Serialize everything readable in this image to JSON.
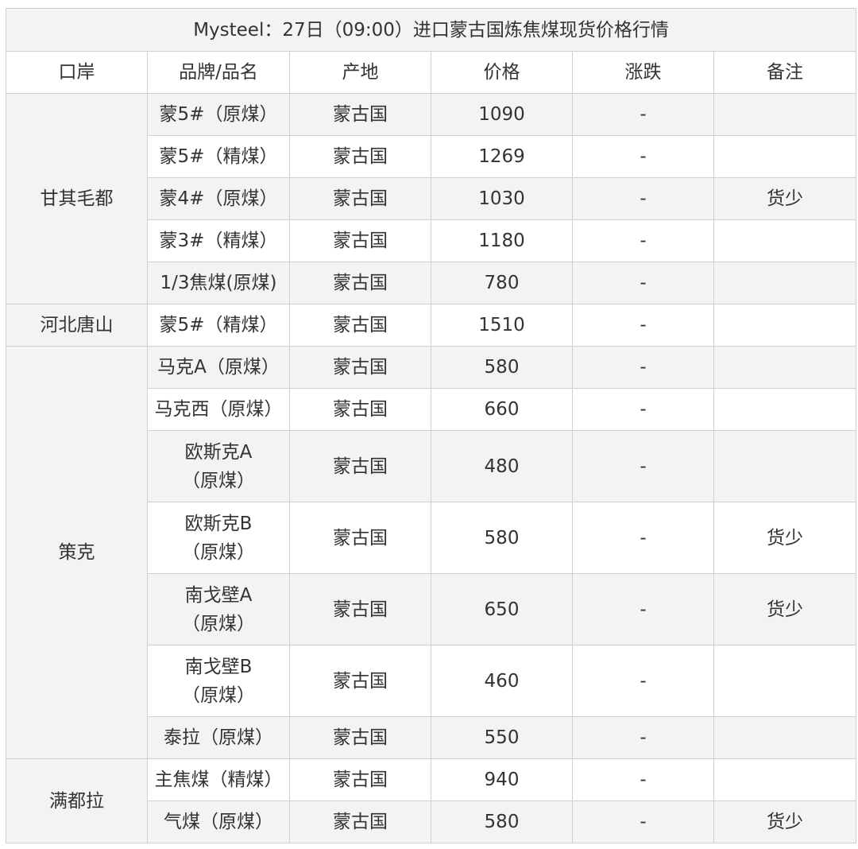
{
  "table": {
    "caption": "Mysteel：27日（09:00）进口蒙古国炼焦煤现货价格行情",
    "headers": [
      "口岸",
      "品牌/品名",
      "产地",
      "价格",
      "涨跌",
      "备注"
    ],
    "groups": [
      {
        "port": "甘其毛都",
        "rows": [
          {
            "name": "蒙5#（原煤）",
            "origin": "蒙古国",
            "price": "1090",
            "change": "-",
            "note": ""
          },
          {
            "name": "蒙5#（精煤）",
            "origin": "蒙古国",
            "price": "1269",
            "change": "-",
            "note": ""
          },
          {
            "name": "蒙4#（原煤）",
            "origin": "蒙古国",
            "price": "1030",
            "change": "-",
            "note": "货少"
          },
          {
            "name": "蒙3#（精煤）",
            "origin": "蒙古国",
            "price": "1180",
            "change": "-",
            "note": ""
          },
          {
            "name": "1/3焦煤(原煤)",
            "origin": "蒙古国",
            "price": "780",
            "change": "-",
            "note": ""
          }
        ]
      },
      {
        "port": "河北唐山",
        "rows": [
          {
            "name": "蒙5#（精煤）",
            "origin": "蒙古国",
            "price": "1510",
            "change": "-",
            "note": ""
          }
        ]
      },
      {
        "port": "策克",
        "rows": [
          {
            "name": "马克A（原煤）",
            "origin": "蒙古国",
            "price": "580",
            "change": "-",
            "note": ""
          },
          {
            "name": "马克西（原煤）",
            "origin": "蒙古国",
            "price": "660",
            "change": "-",
            "note": ""
          },
          {
            "name": "欧斯克A（原煤）",
            "origin": "蒙古国",
            "price": "480",
            "change": "-",
            "note": ""
          },
          {
            "name": "欧斯克B（原煤）",
            "origin": "蒙古国",
            "price": "580",
            "change": "-",
            "note": "货少"
          },
          {
            "name": "南戈壁A（原煤）",
            "origin": "蒙古国",
            "price": "650",
            "change": "-",
            "note": "货少"
          },
          {
            "name": "南戈壁B（原煤）",
            "origin": "蒙古国",
            "price": "460",
            "change": "-",
            "note": ""
          },
          {
            "name": "泰拉（原煤）",
            "origin": "蒙古国",
            "price": "550",
            "change": "-",
            "note": ""
          }
        ]
      },
      {
        "port": "满都拉",
        "rows": [
          {
            "name": "主焦煤（精煤）",
            "origin": "蒙古国",
            "price": "940",
            "change": "-",
            "note": ""
          },
          {
            "name": "气煤（原煤）",
            "origin": "蒙古国",
            "price": "580",
            "change": "-",
            "note": "货少"
          }
        ]
      }
    ]
  }
}
